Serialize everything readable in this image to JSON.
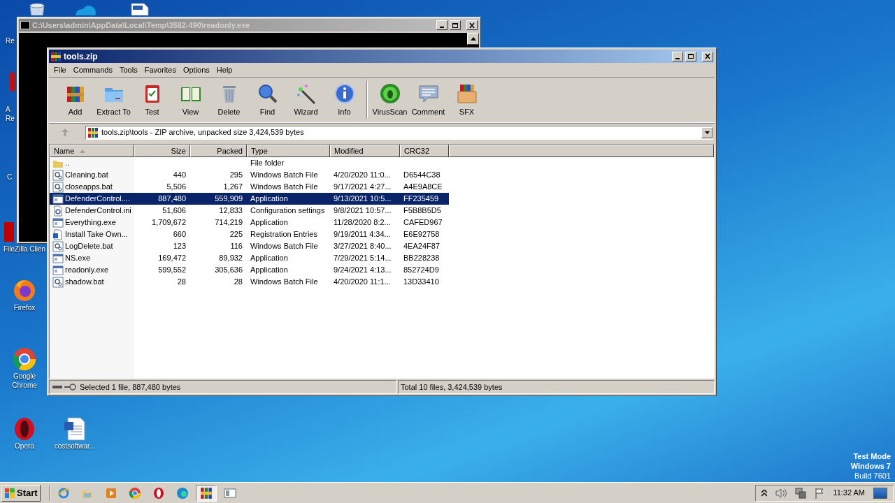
{
  "desktop": {
    "icons": [
      {
        "kind": "bin"
      },
      {
        "kind": "cloud"
      },
      {
        "kind": "doc"
      },
      {
        "kind": "bin",
        "lines": [
          "Re"
        ]
      },
      {
        "kind": "redapp",
        "lines": [
          "A",
          "Re"
        ]
      },
      {
        "kind": "app",
        "lines": [
          "C"
        ]
      },
      {
        "kind": "filezilla",
        "lines": [
          "FileZilla Clien"
        ]
      },
      {
        "kind": "firefox",
        "lines": [
          "Firefox"
        ]
      },
      {
        "kind": "chrome",
        "lines": [
          "Google",
          "Chrome"
        ]
      },
      {
        "kind": "opera",
        "lines": [
          "Opera"
        ]
      },
      {
        "kind": "word",
        "lines": [
          "costsoftwar..."
        ]
      }
    ],
    "test_mode": [
      "Test Mode",
      "Windows 7",
      "Build 7601"
    ]
  },
  "console": {
    "title": "C:\\Users\\admin\\AppData\\Local\\Temp\\3582-490\\readonly.exe"
  },
  "winrar": {
    "title": "tools.zip",
    "menu": [
      "File",
      "Commands",
      "Tools",
      "Favorites",
      "Options",
      "Help"
    ],
    "toolbar": [
      {
        "kind": "add",
        "label": "Add",
        "separator_before": false
      },
      {
        "kind": "extract",
        "label": "Extract To",
        "separator_before": false
      },
      {
        "kind": "test",
        "label": "Test",
        "separator_before": false
      },
      {
        "kind": "view",
        "label": "View",
        "separator_before": false
      },
      {
        "kind": "delete",
        "label": "Delete",
        "separator_before": false
      },
      {
        "kind": "find",
        "label": "Find",
        "separator_before": false
      },
      {
        "kind": "wizard",
        "label": "Wizard",
        "separator_before": false
      },
      {
        "kind": "info",
        "label": "Info",
        "separator_before": false
      },
      {
        "kind": "virusscan",
        "label": "VirusScan",
        "separator_before": true
      },
      {
        "kind": "comment",
        "label": "Comment",
        "separator_before": false
      },
      {
        "kind": "sfx",
        "label": "SFX",
        "separator_before": false
      }
    ],
    "address": "tools.zip\\tools - ZIP archive, unpacked size 3,424,539 bytes",
    "columns": [
      {
        "label": "Name",
        "sorted": true
      },
      {
        "label": "Size",
        "sorted": false
      },
      {
        "label": "Packed",
        "sorted": false
      },
      {
        "label": "Type",
        "sorted": false
      },
      {
        "label": "Modified",
        "sorted": false
      },
      {
        "label": "CRC32",
        "sorted": false
      }
    ],
    "rows": [
      {
        "kind": "folder",
        "name": "..",
        "type": "File folder",
        "selected": false
      },
      {
        "kind": "bat",
        "name": "Cleaning.bat",
        "size": "440",
        "packed": "295",
        "type": "Windows Batch File",
        "modified": "4/20/2020 11:0...",
        "crc": "D6544C38",
        "selected": false
      },
      {
        "kind": "bat",
        "name": "closeapps.bat",
        "size": "5,506",
        "packed": "1,267",
        "type": "Windows Batch File",
        "modified": "9/17/2021 4:27...",
        "crc": "A4E9A8CE",
        "selected": false
      },
      {
        "kind": "exe",
        "name": "DefenderControl....",
        "size": "887,480",
        "packed": "559,909",
        "type": "Application",
        "modified": "9/13/2021 10:5...",
        "crc": "FF235459",
        "selected": true
      },
      {
        "kind": "ini",
        "name": "DefenderControl.ini",
        "size": "51,606",
        "packed": "12,833",
        "type": "Configuration settings",
        "modified": "9/8/2021 10:57...",
        "crc": "F5B8B5D5",
        "selected": false
      },
      {
        "kind": "exe",
        "name": "Everything.exe",
        "size": "1,709,672",
        "packed": "714,219",
        "type": "Application",
        "modified": "11/28/2020 8:2...",
        "crc": "CAFED967",
        "selected": false
      },
      {
        "kind": "reg",
        "name": "Install Take Own...",
        "size": "660",
        "packed": "225",
        "type": "Registration Entries",
        "modified": "9/19/2011 4:34...",
        "crc": "E6E92758",
        "selected": false
      },
      {
        "kind": "bat",
        "name": "LogDelete.bat",
        "size": "123",
        "packed": "116",
        "type": "Windows Batch File",
        "modified": "3/27/2021 8:40...",
        "crc": "4EA24F87",
        "selected": false
      },
      {
        "kind": "exe",
        "name": "NS.exe",
        "size": "169,472",
        "packed": "89,932",
        "type": "Application",
        "modified": "7/29/2021 5:14...",
        "crc": "BB228238",
        "selected": false
      },
      {
        "kind": "exe",
        "name": "readonly.exe",
        "size": "599,552",
        "packed": "305,636",
        "type": "Application",
        "modified": "9/24/2021 4:13...",
        "crc": "852724D9",
        "selected": false
      },
      {
        "kind": "bat",
        "name": "shadow.bat",
        "size": "28",
        "packed": "28",
        "type": "Windows Batch File",
        "modified": "4/20/2020 11:1...",
        "crc": "13D33410",
        "selected": false
      }
    ],
    "status": {
      "selection": "Selected 1 file, 887,480 bytes",
      "total": "Total 10 files, 3,424,539 bytes"
    }
  },
  "taskbar": {
    "start": "Start",
    "apps": [
      {
        "kind": "ie",
        "selected": false
      },
      {
        "kind": "explorer",
        "selected": false
      },
      {
        "kind": "media",
        "selected": false
      },
      {
        "kind": "chrome",
        "selected": false
      },
      {
        "kind": "opera",
        "selected": false
      },
      {
        "kind": "edge",
        "selected": false
      },
      {
        "kind": "winrar",
        "selected": true
      },
      {
        "kind": "console",
        "selected": false
      }
    ],
    "clock": "11:32 AM"
  }
}
